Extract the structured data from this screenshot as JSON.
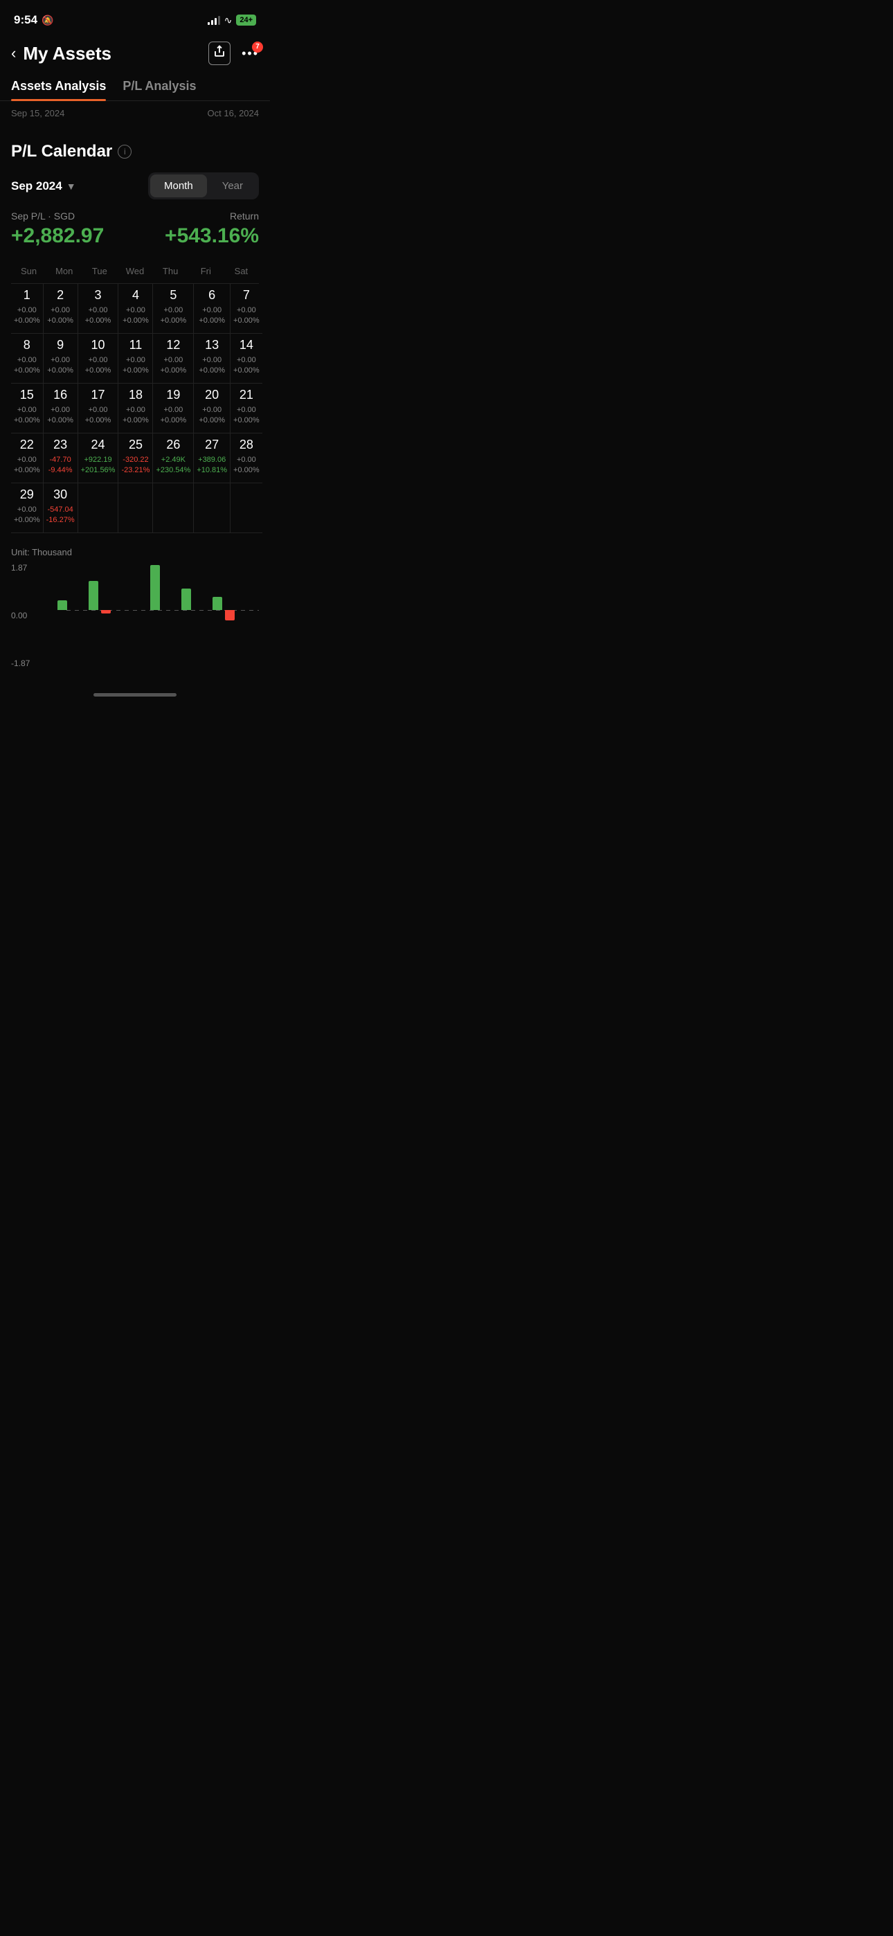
{
  "statusBar": {
    "time": "9:54",
    "bellIcon": "🔕",
    "batteryText": "24+",
    "signalBars": [
      4,
      7,
      10,
      13
    ],
    "notificationCount": "7"
  },
  "header": {
    "title": "My Assets",
    "backLabel": "‹",
    "shareIcon": "⬆",
    "moreIcon": "•••"
  },
  "tabs": [
    {
      "id": "assets",
      "label": "Assets Analysis",
      "active": true
    },
    {
      "id": "pl",
      "label": "P/L Analysis",
      "active": false
    }
  ],
  "dateRange": {
    "start": "Sep 15, 2024",
    "end": "Oct 16, 2024"
  },
  "plCalendar": {
    "title": "P/L Calendar",
    "infoIcon": "i",
    "period": "Sep 2024",
    "toggleOptions": [
      "Month",
      "Year"
    ],
    "activeToggle": "Month",
    "summaryLabel": "Sep P/L · SGD",
    "summaryValue": "+2,882.97",
    "returnLabel": "Return",
    "returnValue": "+543.16%",
    "dayNames": [
      "Sun",
      "Mon",
      "Tue",
      "Wed",
      "Thu",
      "Fri",
      "Sat"
    ],
    "weeks": [
      [
        {
          "date": "1",
          "pl": "+0.00",
          "pct": "+0.00%",
          "type": "zero"
        },
        {
          "date": "2",
          "pl": "+0.00",
          "pct": "+0.00%",
          "type": "zero"
        },
        {
          "date": "3",
          "pl": "+0.00",
          "pct": "+0.00%",
          "type": "zero"
        },
        {
          "date": "4",
          "pl": "+0.00",
          "pct": "+0.00%",
          "type": "zero"
        },
        {
          "date": "5",
          "pl": "+0.00",
          "pct": "+0.00%",
          "type": "zero"
        },
        {
          "date": "6",
          "pl": "+0.00",
          "pct": "+0.00%",
          "type": "zero"
        },
        {
          "date": "7",
          "pl": "+0.00",
          "pct": "+0.00%",
          "type": "zero"
        }
      ],
      [
        {
          "date": "8",
          "pl": "+0.00",
          "pct": "+0.00%",
          "type": "zero"
        },
        {
          "date": "9",
          "pl": "+0.00",
          "pct": "+0.00%",
          "type": "zero"
        },
        {
          "date": "10",
          "pl": "+0.00",
          "pct": "+0.00%",
          "type": "zero"
        },
        {
          "date": "11",
          "pl": "+0.00",
          "pct": "+0.00%",
          "type": "zero"
        },
        {
          "date": "12",
          "pl": "+0.00",
          "pct": "+0.00%",
          "type": "zero"
        },
        {
          "date": "13",
          "pl": "+0.00",
          "pct": "+0.00%",
          "type": "zero"
        },
        {
          "date": "14",
          "pl": "+0.00",
          "pct": "+0.00%",
          "type": "zero"
        }
      ],
      [
        {
          "date": "15",
          "pl": "+0.00",
          "pct": "+0.00%",
          "type": "zero"
        },
        {
          "date": "16",
          "pl": "+0.00",
          "pct": "+0.00%",
          "type": "zero"
        },
        {
          "date": "17",
          "pl": "+0.00",
          "pct": "+0.00%",
          "type": "zero"
        },
        {
          "date": "18",
          "pl": "+0.00",
          "pct": "+0.00%",
          "type": "zero"
        },
        {
          "date": "19",
          "pl": "+0.00",
          "pct": "+0.00%",
          "type": "zero"
        },
        {
          "date": "20",
          "pl": "+0.00",
          "pct": "+0.00%",
          "type": "zero"
        },
        {
          "date": "21",
          "pl": "+0.00",
          "pct": "+0.00%",
          "type": "zero"
        }
      ],
      [
        {
          "date": "22",
          "pl": "+0.00",
          "pct": "+0.00%",
          "type": "zero"
        },
        {
          "date": "23",
          "pl": "-47.70",
          "pct": "-9.44%",
          "type": "negative"
        },
        {
          "date": "24",
          "pl": "+922.19",
          "pct": "+201.56%",
          "type": "positive"
        },
        {
          "date": "25",
          "pl": "-320.22",
          "pct": "-23.21%",
          "type": "negative"
        },
        {
          "date": "26",
          "pl": "+2.49K",
          "pct": "+230.54%",
          "type": "positive"
        },
        {
          "date": "27",
          "pl": "+389.06",
          "pct": "+10.81%",
          "type": "positive"
        },
        {
          "date": "28",
          "pl": "+0.00",
          "pct": "+0.00%",
          "type": "zero"
        }
      ],
      [
        {
          "date": "29",
          "pl": "+0.00",
          "pct": "+0.00%",
          "type": "zero"
        },
        {
          "date": "30",
          "pl": "-547.04",
          "pct": "-16.27%",
          "type": "negative"
        },
        null,
        null,
        null,
        null,
        null
      ]
    ]
  },
  "chart": {
    "unitLabel": "Unit: Thousand",
    "yLabels": [
      "1.87",
      "0.00",
      "-1.87"
    ],
    "bars": [
      {
        "pos": 20,
        "neg": 0
      },
      {
        "pos": 62,
        "neg": 0
      },
      {
        "pos": 0,
        "neg": 8
      },
      {
        "pos": 95,
        "neg": 0
      },
      {
        "pos": 45,
        "neg": 0
      },
      {
        "pos": 28,
        "neg": 0
      },
      {
        "pos": 0,
        "neg": 22
      }
    ]
  }
}
